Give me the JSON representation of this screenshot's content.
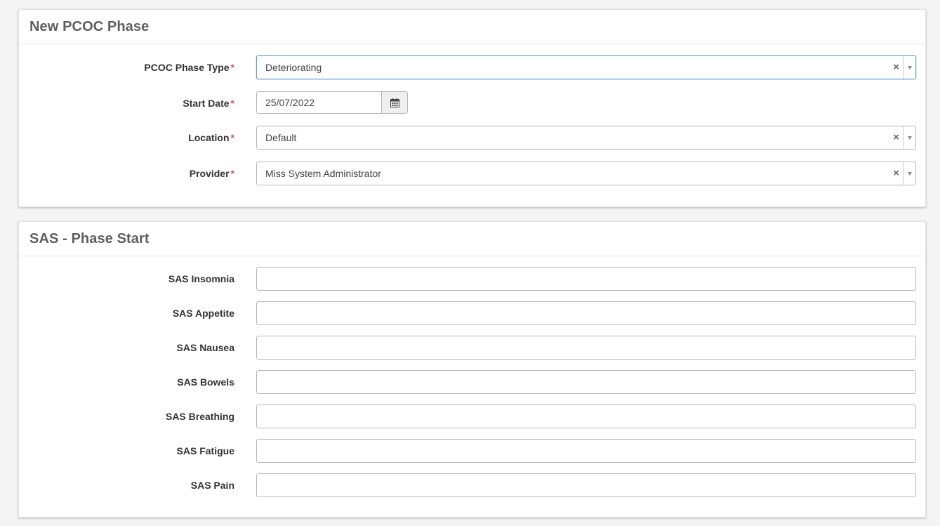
{
  "phase_panel": {
    "title": "New PCOC Phase",
    "fields": {
      "phase_type": {
        "label": "PCOC Phase Type",
        "required": "*",
        "value": "Deteriorating",
        "clear": "×"
      },
      "start_date": {
        "label": "Start Date",
        "required": "*",
        "value": "25/07/2022"
      },
      "location": {
        "label": "Location",
        "required": "*",
        "value": "Default",
        "clear": "×"
      },
      "provider": {
        "label": "Provider",
        "required": "*",
        "value": "Miss System Administrator",
        "clear": "×"
      }
    }
  },
  "sas_panel": {
    "title": "SAS - Phase Start",
    "fields": [
      {
        "label": "SAS Insomnia",
        "value": ""
      },
      {
        "label": "SAS Appetite",
        "value": ""
      },
      {
        "label": "SAS Nausea",
        "value": ""
      },
      {
        "label": "SAS Bowels",
        "value": ""
      },
      {
        "label": "SAS Breathing",
        "value": ""
      },
      {
        "label": "SAS Fatigue",
        "value": ""
      },
      {
        "label": "SAS Pain",
        "value": ""
      }
    ]
  },
  "icons": {
    "calendar": "calendar-icon",
    "clear": "clear-icon",
    "dropdown": "chevron-down-icon"
  },
  "colors": {
    "required": "#d9534f",
    "focus_border": "#6a9fd4",
    "title": "#5f5f5f"
  }
}
